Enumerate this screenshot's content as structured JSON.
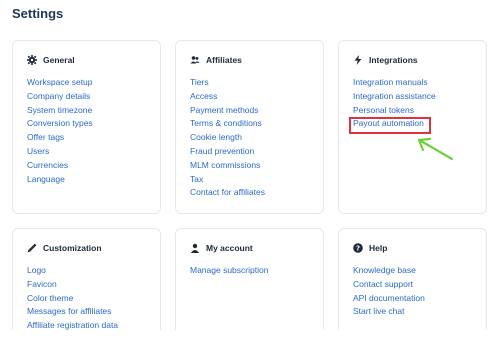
{
  "page": {
    "title": "Settings"
  },
  "cards": {
    "general": {
      "title": "General",
      "icon": "gear-icon",
      "links": [
        "Workspace setup",
        "Company details",
        "System timezone",
        "Conversion types",
        "Offer tags",
        "Users",
        "Currencies",
        "Language"
      ]
    },
    "affiliates": {
      "title": "Affiliates",
      "icon": "users-icon",
      "links": [
        "Tiers",
        "Access",
        "Payment methods",
        "Terms & conditions",
        "Cookie length",
        "Fraud prevention",
        "MLM commissions",
        "Tax",
        "Contact for affiliates"
      ]
    },
    "integrations": {
      "title": "Integrations",
      "icon": "bolt-icon",
      "links": [
        "Integration manuals",
        "Integration assistance",
        "Personal tokens",
        "Payout automation"
      ]
    },
    "customization": {
      "title": "Customization",
      "icon": "pen-icon",
      "links": [
        "Logo",
        "Favicon",
        "Color theme",
        "Messages for affiliates",
        "Affiliate registration data"
      ]
    },
    "account": {
      "title": "My account",
      "icon": "user-icon",
      "links": [
        "Manage subscription"
      ]
    },
    "help": {
      "title": "Help",
      "icon": "question-circle-icon",
      "links": [
        "Knowledge base",
        "Contact support",
        "API documentation",
        "Start live chat"
      ]
    }
  },
  "annotation": {
    "highlight_color": "#e0323a",
    "arrow_color": "#6fd13a"
  },
  "colors": {
    "link": "#2b6bc3",
    "title": "#1f3656",
    "card_border": "#e4e7ec"
  }
}
